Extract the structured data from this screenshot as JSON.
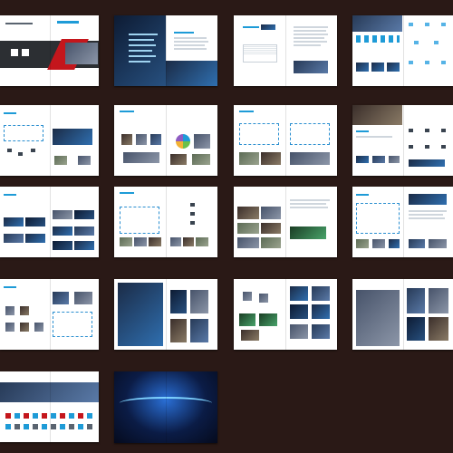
{
  "canvas": {
    "background": "#2a1916"
  },
  "colors": {
    "accent": "#1e9bd7",
    "cover_dark": "#2c2f33",
    "cover_red": "#c4161c",
    "page": "#ffffff"
  },
  "spreads": [
    {
      "id": "s1",
      "content": "cover-dark-red"
    },
    {
      "id": "s2",
      "content": "city-blue-text"
    },
    {
      "id": "s3",
      "content": "table-and-text"
    },
    {
      "id": "s4",
      "content": "photo-icons-diagram"
    },
    {
      "id": "s5",
      "content": "diagram-screens"
    },
    {
      "id": "s6",
      "content": "devices-pie"
    },
    {
      "id": "s7",
      "content": "diagram-photos"
    },
    {
      "id": "s8",
      "content": "photo-devices"
    },
    {
      "id": "s9",
      "content": "screens-grid"
    },
    {
      "id": "s10",
      "content": "diagram-racks"
    },
    {
      "id": "s11",
      "content": "gates-photos"
    },
    {
      "id": "s12",
      "content": "diagram-app"
    },
    {
      "id": "s13",
      "content": "products-diagram"
    },
    {
      "id": "s14",
      "content": "server-rooms"
    },
    {
      "id": "s15",
      "content": "cameras-rooms"
    },
    {
      "id": "s16",
      "content": "buildings"
    },
    {
      "id": "s17",
      "content": "handshake-logos"
    },
    {
      "id": "s18",
      "content": "earth-city-back-cover"
    }
  ]
}
